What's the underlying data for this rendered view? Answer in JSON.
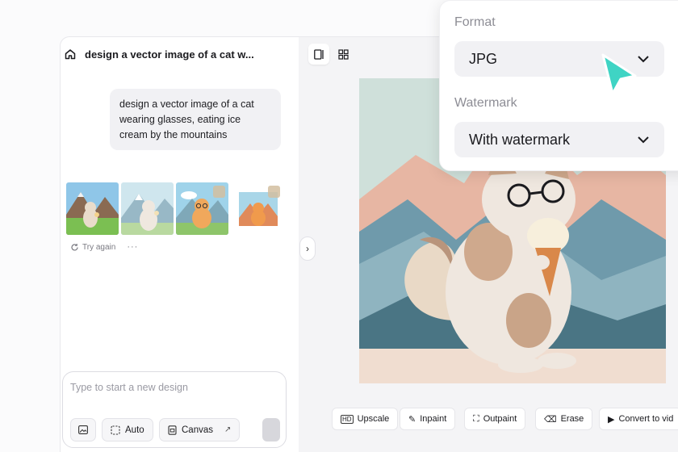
{
  "chat": {
    "title": "design a vector image of a cat w...",
    "prompt": "design a vector image of a cat wearing glasses, eating ice cream by the mountains",
    "try_again": "Try again",
    "more": "···"
  },
  "composer": {
    "placeholder": "Type to start a new design",
    "auto_label": "Auto",
    "canvas_label": "Canvas"
  },
  "tools": {
    "upscale": "Upscale",
    "inpaint": "Inpaint",
    "outpaint": "Outpaint",
    "erase": "Erase",
    "convert": "Convert to vid"
  },
  "popover": {
    "format_label": "Format",
    "format_value": "JPG",
    "watermark_label": "Watermark",
    "watermark_value": "With watermark"
  },
  "colors": {
    "accent_cursor": "#3fd4c4",
    "panel_bg": "#ffffff",
    "canvas_bg": "#f4f4f6"
  }
}
